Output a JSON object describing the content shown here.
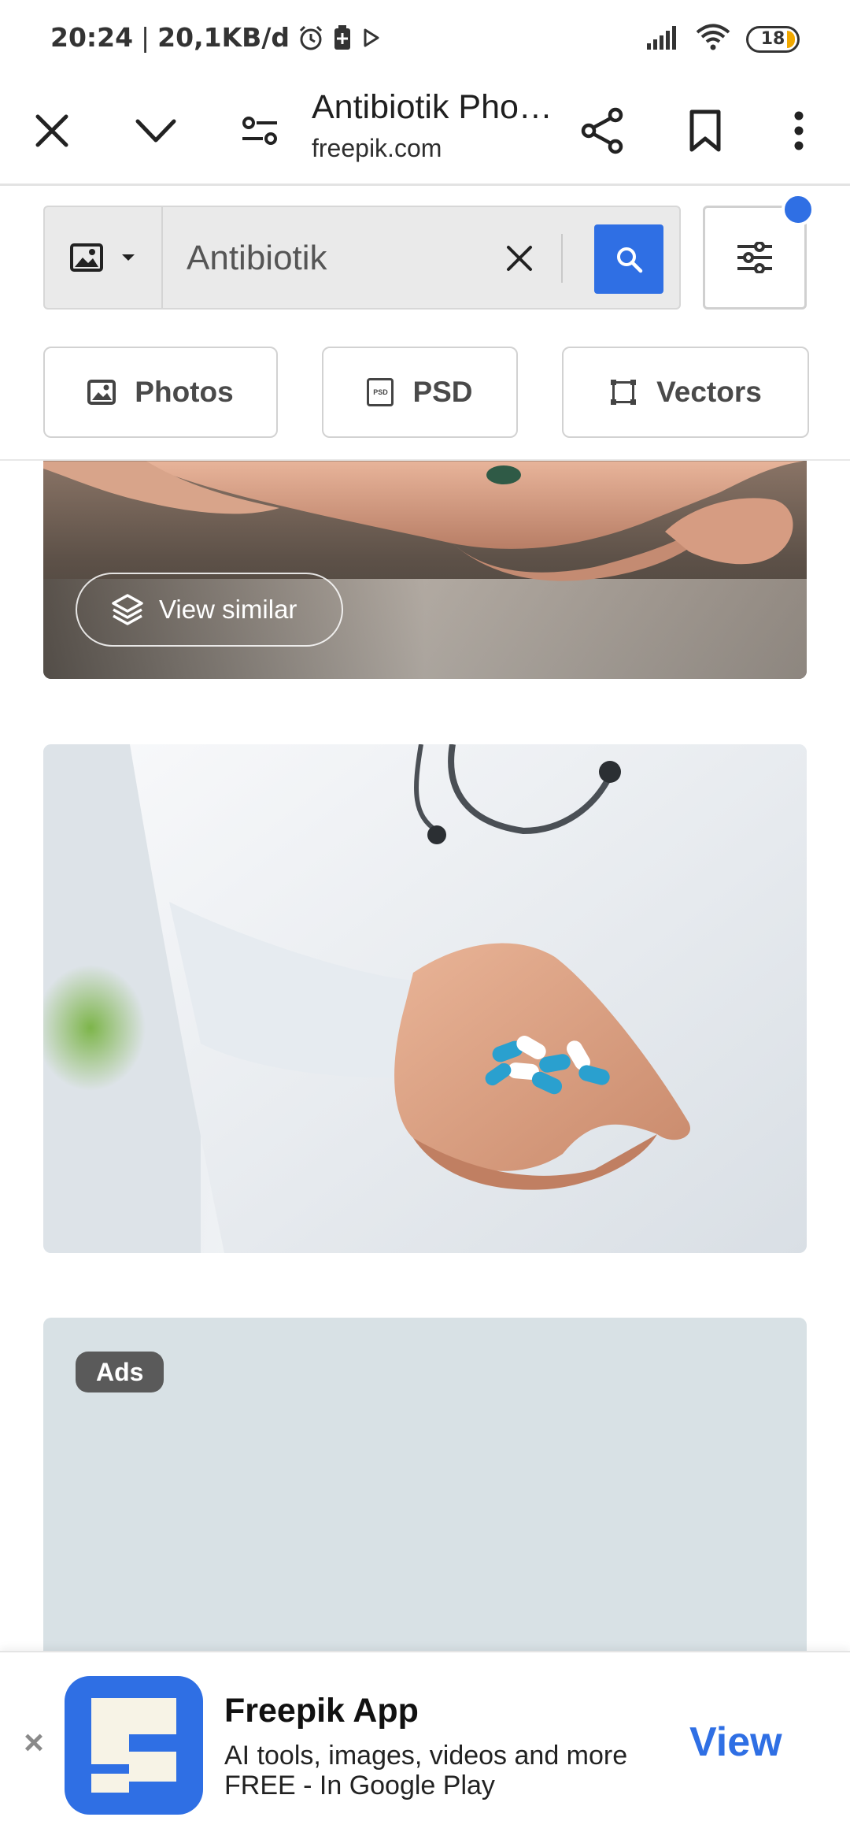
{
  "status_bar": {
    "time": "20:24",
    "speed": "20,1KB/d",
    "battery_level": "18"
  },
  "browser": {
    "page_title": "Antibiotik Pho…",
    "url": "freepik.com"
  },
  "search": {
    "value": "Antibiotik",
    "placeholder": ""
  },
  "filters": {
    "types": [
      {
        "label": "Photos"
      },
      {
        "label": "PSD"
      },
      {
        "label": "Vectors"
      }
    ],
    "psd_icon_text": "PSD"
  },
  "results": {
    "view_similar_label": "View similar",
    "ads_label": "Ads"
  },
  "app_banner": {
    "close_symbol": "×",
    "title": "Freepik App",
    "desc_line1": "AI tools, images, videos and more",
    "desc_line2": "FREE - In Google Play",
    "cta": "View"
  },
  "colors": {
    "accent": "#2f6fe4",
    "battery_fill": "#f2a900"
  }
}
